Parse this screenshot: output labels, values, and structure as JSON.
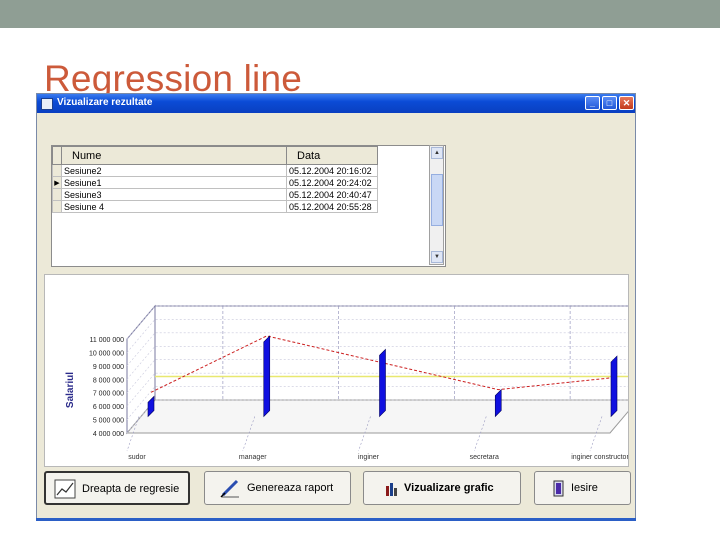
{
  "slide": {
    "title": "Regression line"
  },
  "window": {
    "title": "Vizualizare rezultate",
    "minimize": "_",
    "maximize": "□",
    "close": "✕"
  },
  "grid": {
    "headers": [
      "Nume",
      "Data"
    ],
    "rows": [
      {
        "name": "Sesiune2",
        "date": "05.12.2004 20:16:02",
        "current": false
      },
      {
        "name": "Sesiune1",
        "date": "05.12.2004 20:24:02",
        "current": true
      },
      {
        "name": "Sesiune3",
        "date": "05.12.2004 20:40:47",
        "current": false
      },
      {
        "name": "Sesiune 4",
        "date": "05.12.2004 20:55:28",
        "current": false
      }
    ],
    "scroll_up": "▲",
    "scroll_down": "▼"
  },
  "chart_data": {
    "type": "bar",
    "categories": [
      "sudor",
      "manager",
      "inginer",
      "secretara",
      "inginer constructor"
    ],
    "values": [
      5500000,
      10000000,
      9000000,
      6000000,
      8500000
    ],
    "regression_line": [
      5800000,
      10000000,
      8000000,
      6000000,
      6900000
    ],
    "ylabel": "Salariul",
    "yticks": [
      "4 000 000",
      "5 000 000",
      "6 000 000",
      "7 000 000",
      "8 000 000",
      "9 000 000",
      "10 000 000",
      "11 000 000"
    ],
    "ylim": [
      4000000,
      11000000
    ],
    "grid": true,
    "colors": {
      "bars": "#1010e0",
      "line": "#cc2020",
      "wall_line": "#e8e870"
    }
  },
  "buttons": [
    {
      "label": "Dreapta de regresie",
      "icon": "chart-icon"
    },
    {
      "label": "Genereaza raport",
      "icon": "pen-icon"
    },
    {
      "label": "Vizualizare grafic",
      "icon": "bar-chart-icon"
    },
    {
      "label": "Iesire",
      "icon": "exit-icon"
    }
  ]
}
